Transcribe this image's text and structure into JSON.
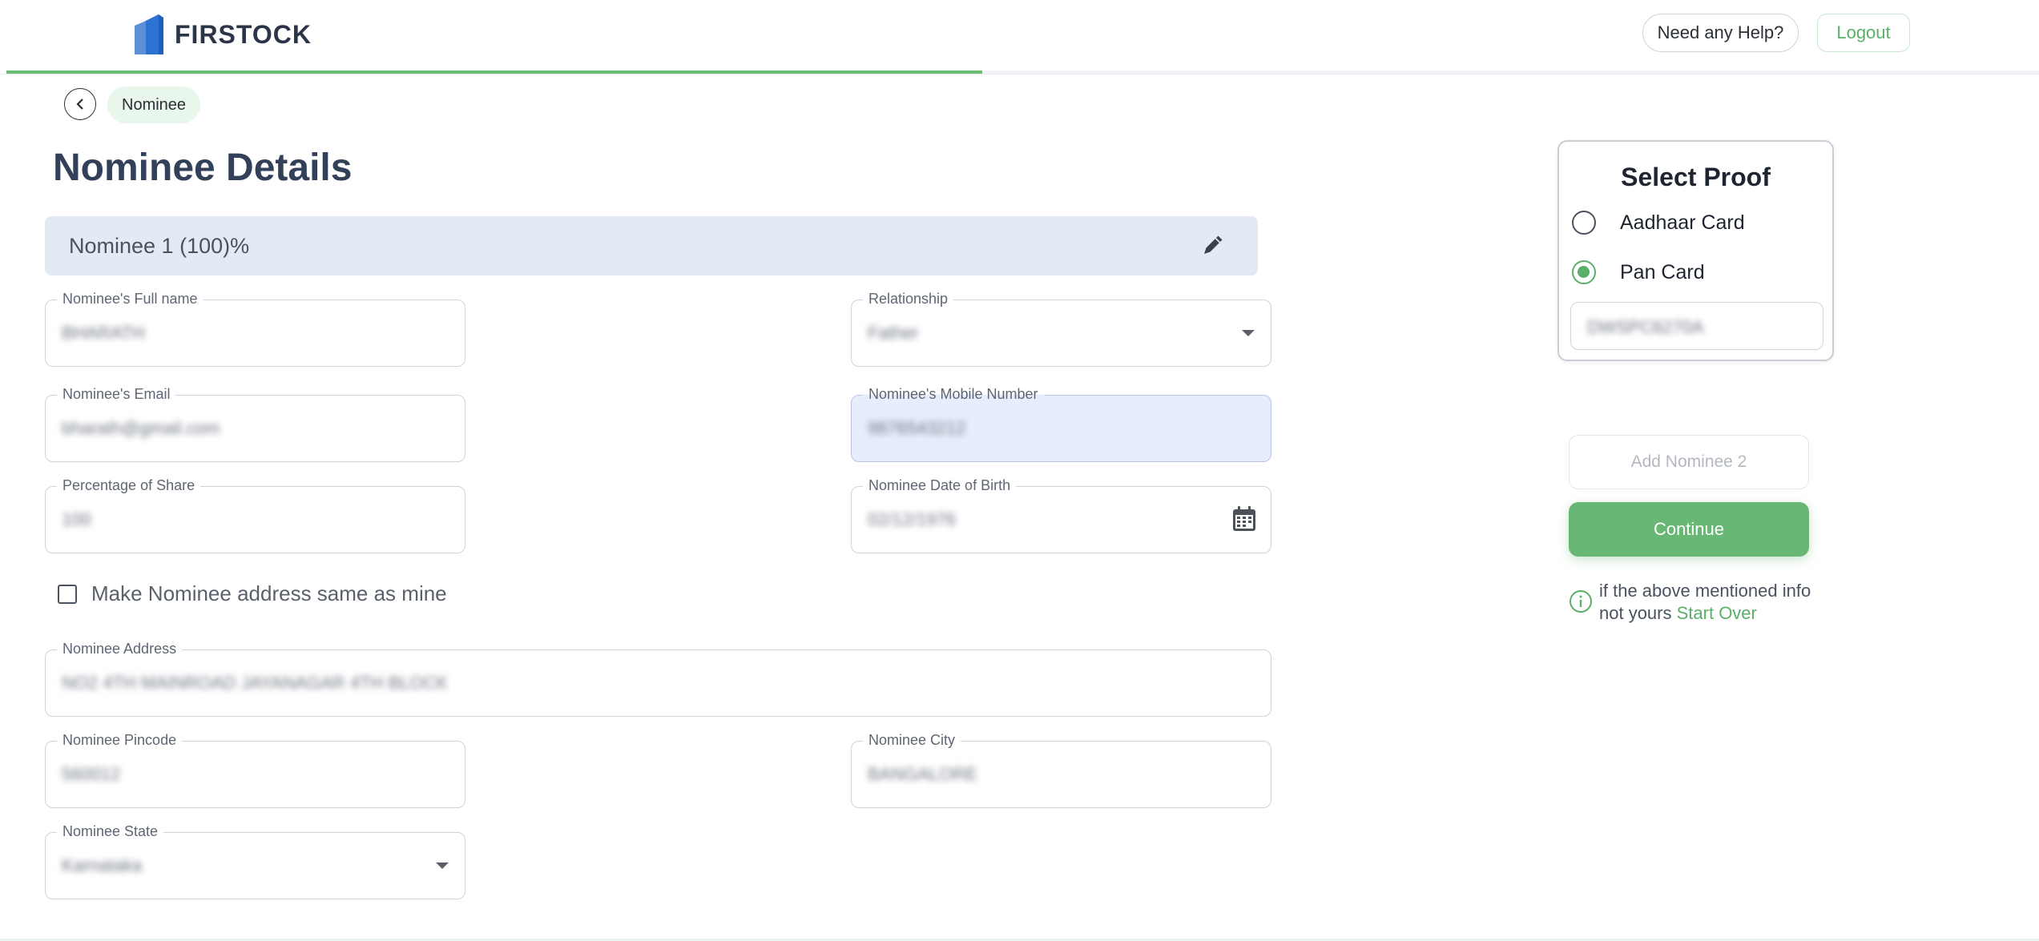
{
  "header": {
    "brand": "FIRSTOCK",
    "help_label": "Need any Help?",
    "logout_label": "Logout",
    "progress_fraction": 0.48
  },
  "breadcrumb": {
    "back_icon": "chevron-left-icon",
    "label": "Nominee"
  },
  "page_title": "Nominee Details",
  "nominee_section": {
    "title": "Nominee 1 (100)%",
    "edit_icon": "pen-icon"
  },
  "fields": {
    "full_name": {
      "label": "Nominee's Full name",
      "value": "BHARATH"
    },
    "relationship": {
      "label": "Relationship",
      "value": "Father"
    },
    "email": {
      "label": "Nominee's Email",
      "value": "bharath@gmail.com"
    },
    "mobile": {
      "label": "Nominee's Mobile Number",
      "value": "9876543212"
    },
    "share": {
      "label": "Percentage of Share",
      "value": "100"
    },
    "dob": {
      "label": "Nominee Date of Birth",
      "value": "02/12/1976"
    },
    "address": {
      "label": "Nominee Address",
      "value": "NO2 4TH MAINROAD JAYANAGAR 4TH BLOCK"
    },
    "pincode": {
      "label": "Nominee Pincode",
      "value": "560012"
    },
    "city": {
      "label": "Nominee City",
      "value": "BANGALORE"
    },
    "state": {
      "label": "Nominee State",
      "value": "Karnataka"
    }
  },
  "same_address": {
    "label": "Make Nominee address same as mine",
    "checked": false
  },
  "proof": {
    "title": "Select Proof",
    "options": [
      {
        "label": "Aadhaar Card",
        "selected": false
      },
      {
        "label": "Pan Card",
        "selected": true
      }
    ],
    "number": "DWSPC6270A"
  },
  "actions": {
    "add_label": "Add Nominee 2",
    "continue_label": "Continue"
  },
  "info": {
    "text": "if the above mentioned info not yours",
    "link": "Start Over"
  },
  "colors": {
    "accent": "#68b774",
    "title": "#33405a",
    "bar": "#e4eaf3"
  }
}
